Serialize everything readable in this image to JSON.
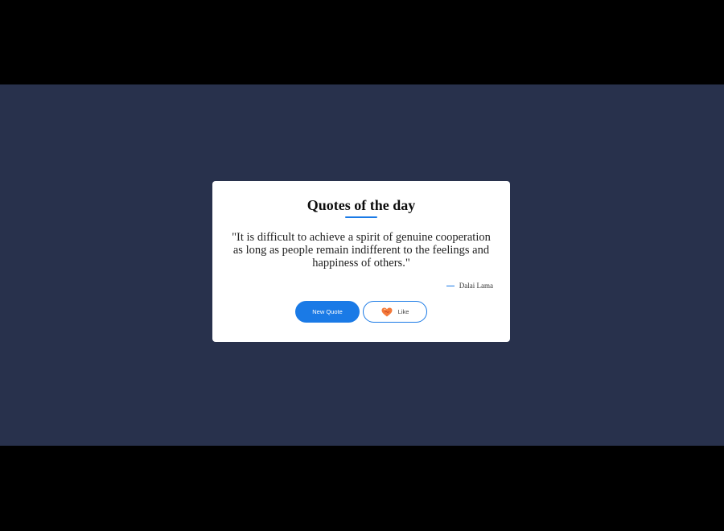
{
  "card": {
    "title": "Quotes of the day",
    "quote": "\"It is difficult to achieve a spirit of genuine cooperation as long as people remain indifferent to the feelings and happiness of others.\"",
    "author": "Dalai Lama"
  },
  "buttons": {
    "new_quote_label": "New Quote",
    "like_label": "Like",
    "like_icon": "heart-icon"
  },
  "colors": {
    "background": "#28314c",
    "accent": "#1a7ae6",
    "card": "#ffffff",
    "letterbox": "#000000"
  }
}
